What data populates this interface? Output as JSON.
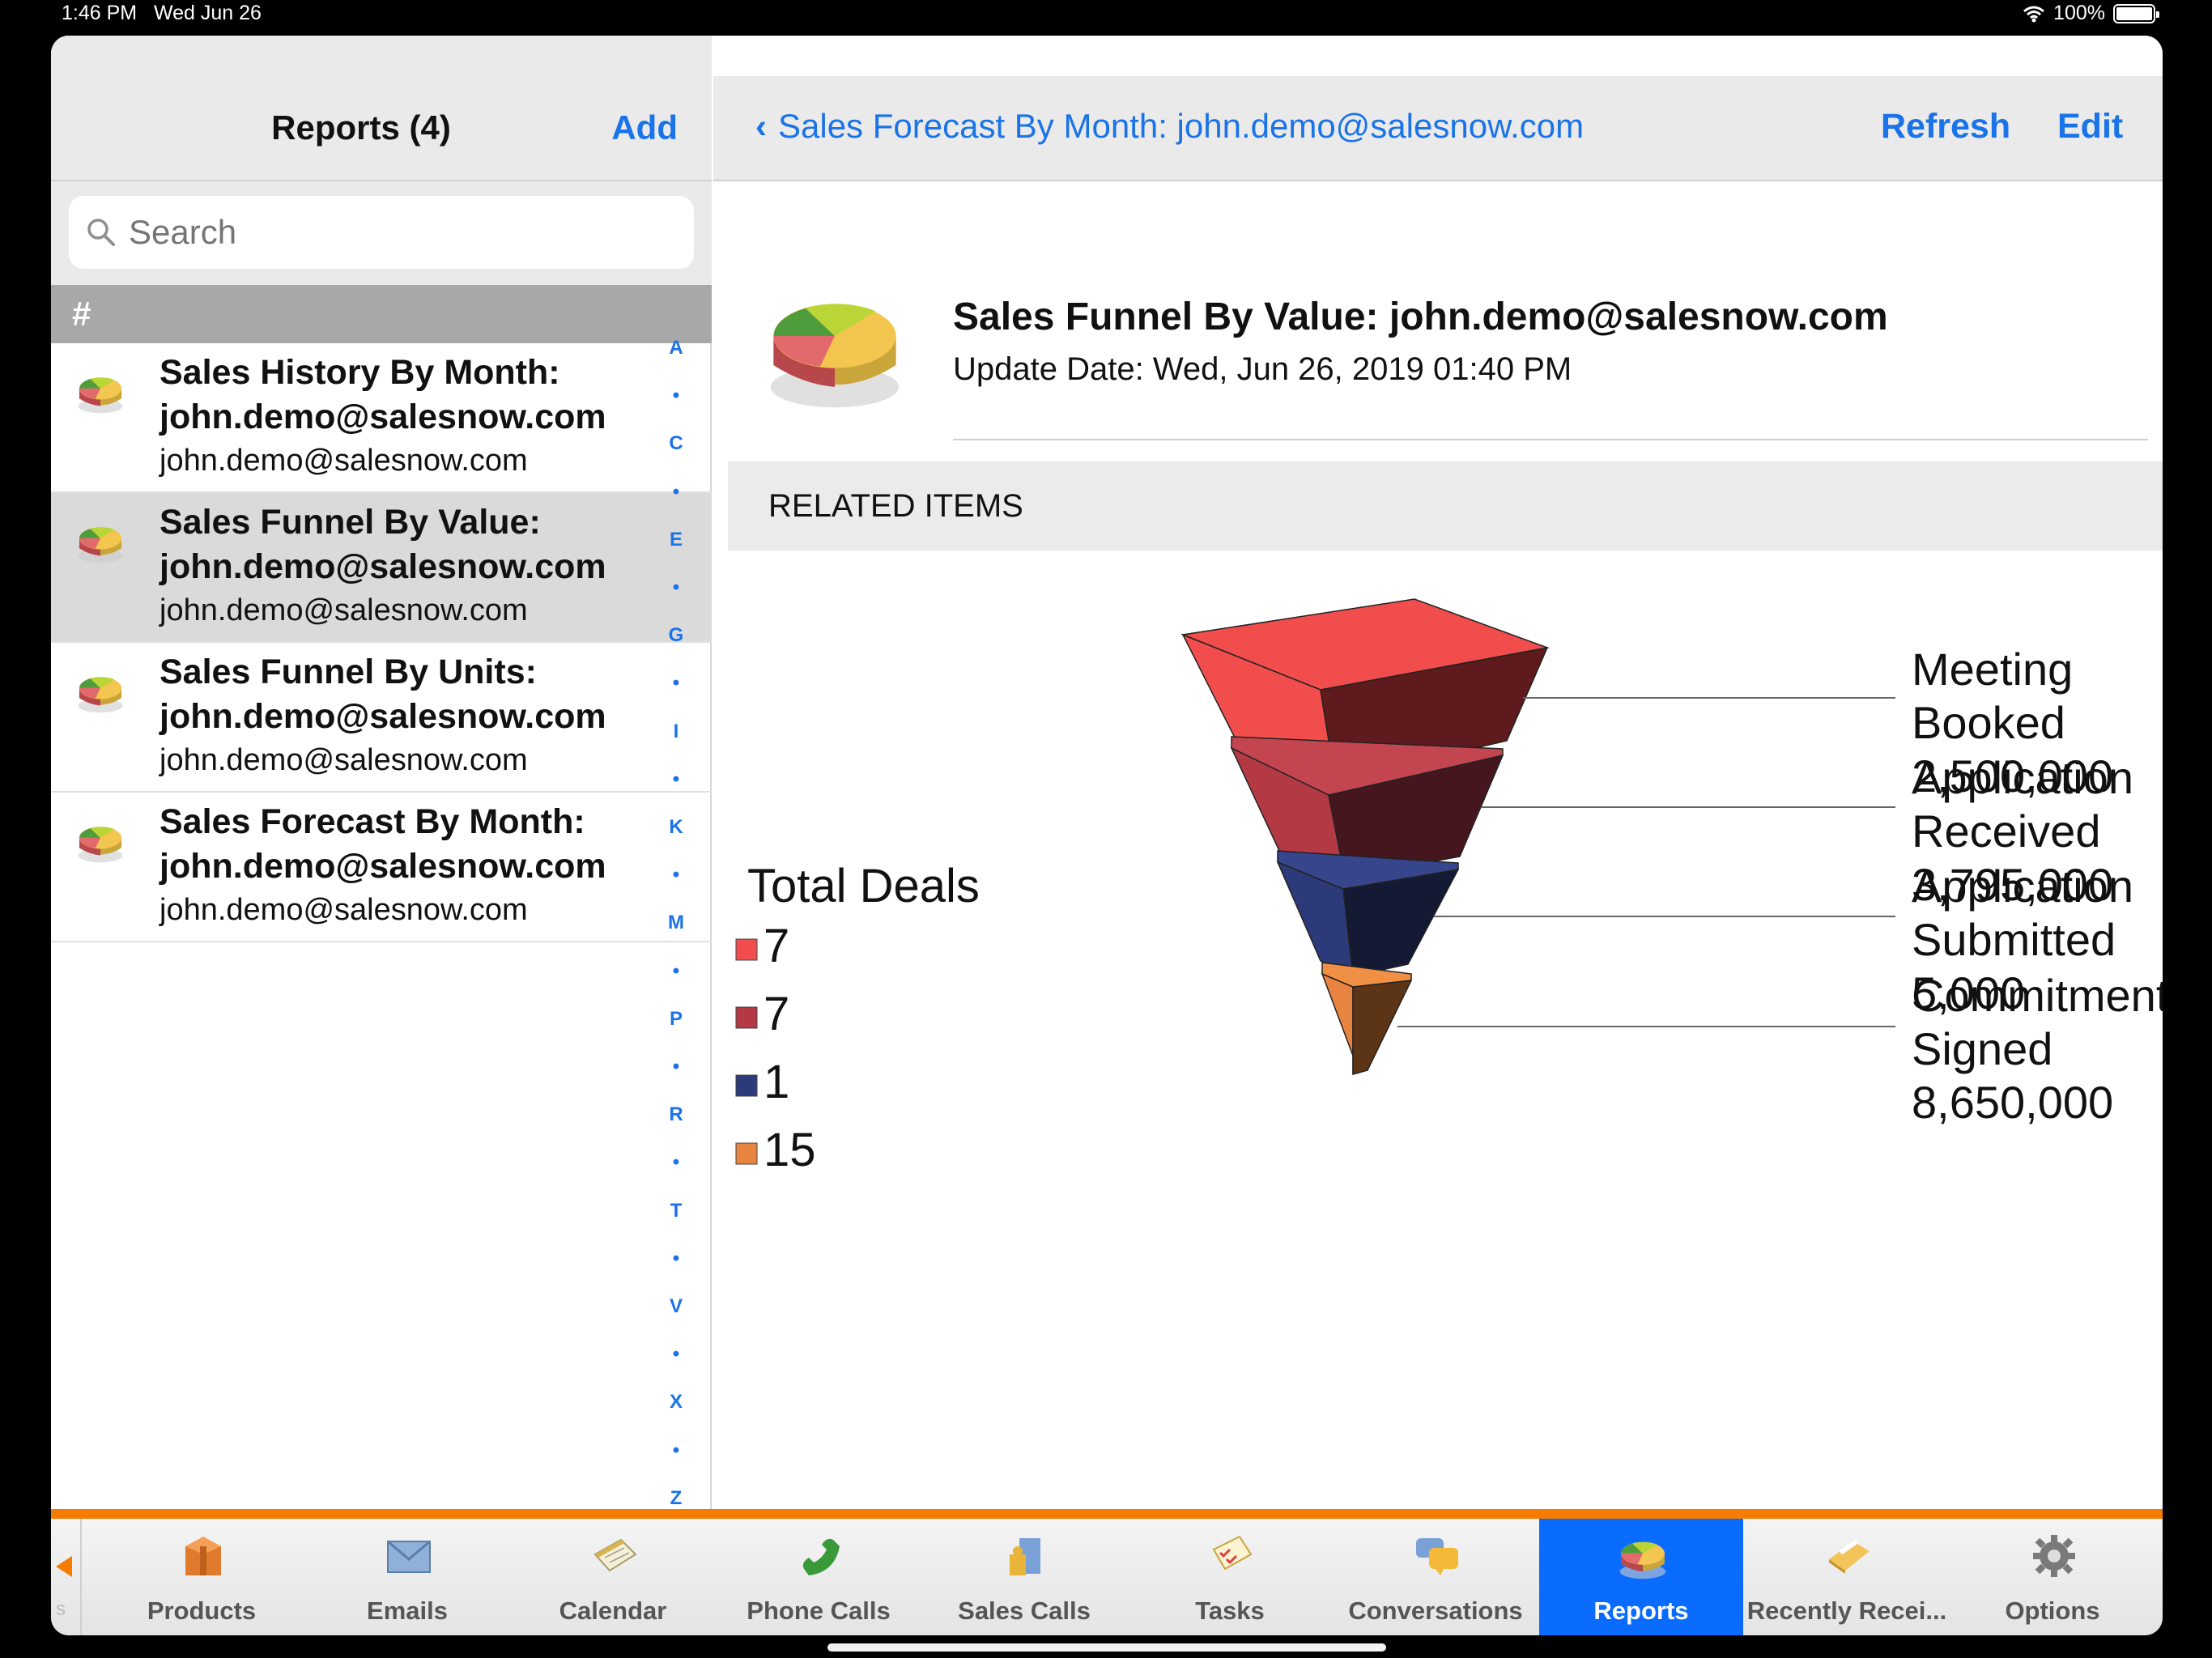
{
  "status_bar": {
    "time": "1:46 PM",
    "date": "Wed Jun 26",
    "battery": "100%"
  },
  "master": {
    "title": "Reports (4)",
    "add_label": "Add",
    "search_placeholder": "Search",
    "section_header": "#",
    "items": [
      {
        "title_line1": "Sales History By Month:",
        "title_line2": "john.demo@salesnow.com",
        "subtitle": "john.demo@salesnow.com",
        "selected": false
      },
      {
        "title_line1": "Sales Funnel By Value:",
        "title_line2": "john.demo@salesnow.com",
        "subtitle": "john.demo@salesnow.com",
        "selected": true
      },
      {
        "title_line1": "Sales Funnel By Units:",
        "title_line2": "john.demo@salesnow.com",
        "subtitle": "john.demo@salesnow.com",
        "selected": false
      },
      {
        "title_line1": "Sales Forecast By Month:",
        "title_line2": "john.demo@salesnow.com",
        "subtitle": "john.demo@salesnow.com",
        "selected": false
      }
    ],
    "index_letters": [
      "A",
      "•",
      "C",
      "•",
      "E",
      "•",
      "G",
      "•",
      "I",
      "•",
      "K",
      "•",
      "M",
      "•",
      "P",
      "•",
      "R",
      "•",
      "T",
      "•",
      "V",
      "•",
      "X",
      "•",
      "Z"
    ]
  },
  "detail": {
    "back_label": "Sales Forecast By Month: john.demo@salesnow.com",
    "refresh_label": "Refresh",
    "edit_label": "Edit",
    "report_title": "Sales Funnel By Value: john.demo@salesnow.com",
    "update_date": "Update Date: Wed, Jun 26, 2019 01:40 PM",
    "related_header": "RELATED ITEMS"
  },
  "chart_data": {
    "type": "funnel",
    "legend_title": "Total Deals",
    "stages": [
      {
        "label_lines": [
          "Meeting",
          "Booked"
        ],
        "value_text": "2,500,000",
        "value": 2500000,
        "deals": 7,
        "color": "#f24d4d",
        "dark": "#5e1a1d",
        "rim": "#e04748"
      },
      {
        "label_lines": [
          "Application",
          "Received"
        ],
        "value_text": "3,795,000",
        "value": 3795000,
        "deals": 7,
        "color": "#b33a44",
        "dark": "#45161d",
        "rim": "#c24550"
      },
      {
        "label_lines": [
          "Application",
          "Submitted"
        ],
        "value_text": "5,000",
        "value": 5000,
        "deals": 1,
        "color": "#2d3a7a",
        "dark": "#141a33",
        "rim": "#36458c"
      },
      {
        "label_lines": [
          "Commitment",
          "Signed"
        ],
        "value_text": "8,650,000",
        "value": 8650000,
        "deals": 15,
        "color": "#e8843f",
        "dark": "#5c3416",
        "rim": "#f09045"
      }
    ]
  },
  "tabs": [
    {
      "label": "Products",
      "icon": "package-icon",
      "active": false
    },
    {
      "label": "Emails",
      "icon": "envelope-icon",
      "active": false
    },
    {
      "label": "Calendar",
      "icon": "calendar-icon",
      "active": false
    },
    {
      "label": "Phone Calls",
      "icon": "phone-icon",
      "active": false
    },
    {
      "label": "Sales Calls",
      "icon": "door-icon",
      "active": false
    },
    {
      "label": "Tasks",
      "icon": "checklist-icon",
      "active": false
    },
    {
      "label": "Conversations",
      "icon": "chat-bubbles-icon",
      "active": false
    },
    {
      "label": "Reports",
      "icon": "pie-chart-icon",
      "active": true
    },
    {
      "label": "Recently Recei...",
      "icon": "folder-icon",
      "active": false
    },
    {
      "label": "Options",
      "icon": "gear-icon",
      "active": false
    }
  ],
  "colors": {
    "accent_blue": "#1a73e8",
    "tab_active": "#0a6cff",
    "tab_orange": "#f57c00"
  }
}
